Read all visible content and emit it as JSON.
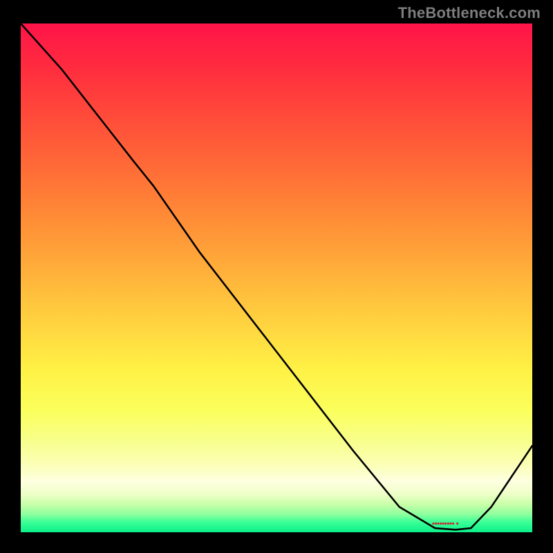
{
  "watermark": "TheBottleneck.com",
  "marker_label": "••••••••• •",
  "colors": {
    "frame_bg": "#000000",
    "curve": "#000000",
    "watermark": "#7d7d7d",
    "marker": "#d21f2b"
  },
  "chart_data": {
    "type": "line",
    "title": "",
    "xlabel": "",
    "ylabel": "",
    "xlim": [
      0,
      100
    ],
    "ylim": [
      0,
      100
    ],
    "x": [
      0,
      8,
      15,
      22,
      26,
      35,
      45,
      55,
      65,
      74,
      81,
      85,
      88,
      92,
      96,
      100
    ],
    "values": [
      100,
      91,
      82,
      73,
      68,
      55,
      42,
      29,
      16,
      5,
      0.8,
      0.5,
      0.8,
      5,
      11,
      17
    ],
    "minimum_x": 83,
    "note": "Single black curve over vertical spectral gradient; minimum (green zone) near x≈83. Values are read relative to the plot area height (100 = top red, 0 = bottom green)."
  }
}
